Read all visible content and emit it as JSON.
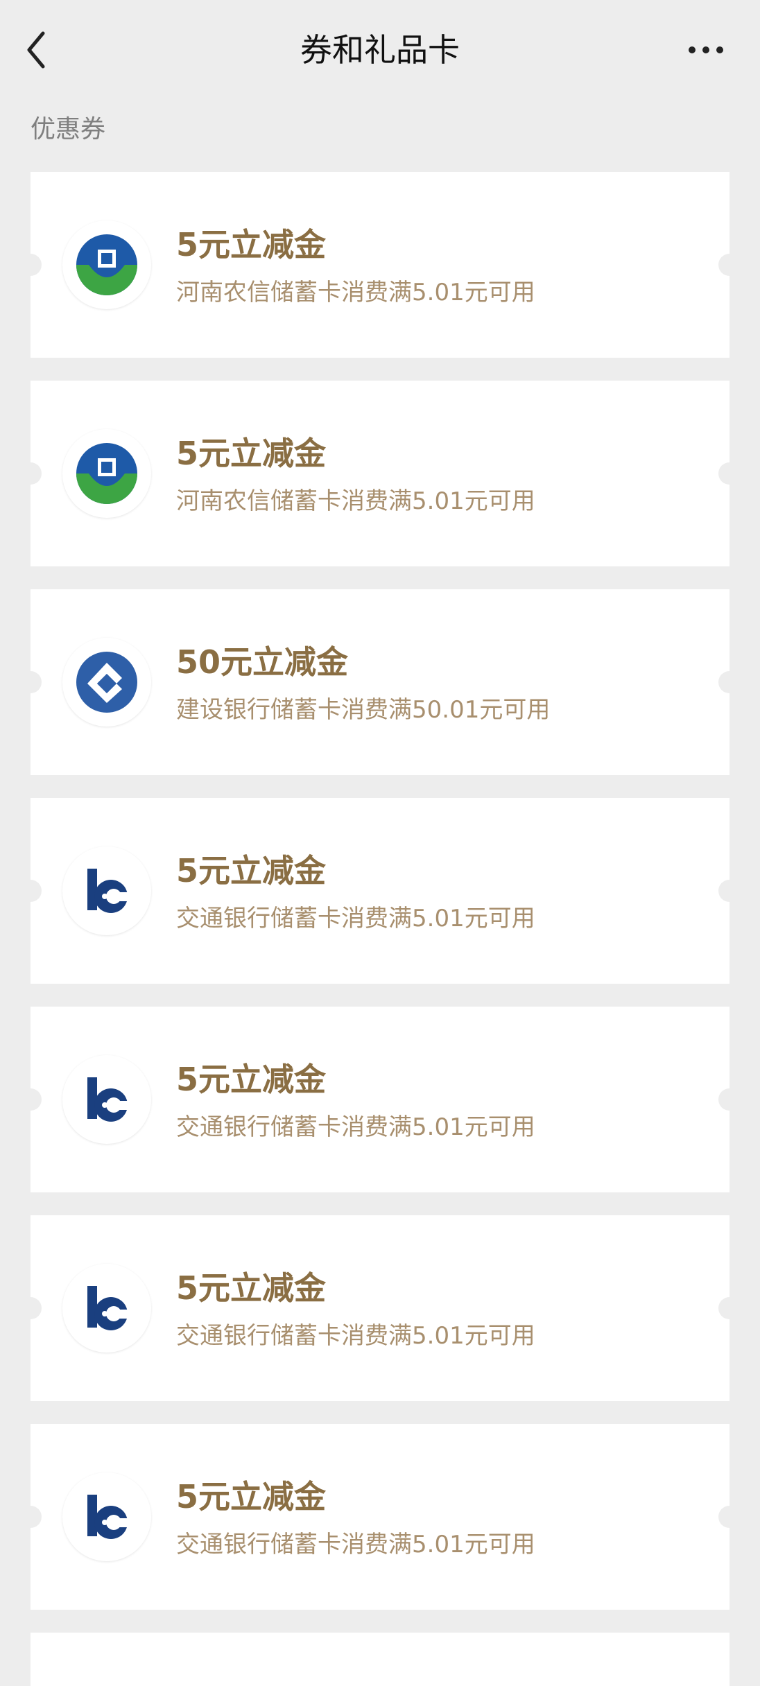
{
  "nav": {
    "title": "券和礼品卡",
    "back_icon": "chevron-left-icon",
    "more_icon": "more-horizontal-icon"
  },
  "section": {
    "label": "优惠券"
  },
  "colors": {
    "background": "#EDEDED",
    "card": "#FFFFFF",
    "coupon_title": "#8A6E43",
    "coupon_desc": "#A88F6E",
    "rural_credit_blue": "#1E5AA8",
    "rural_credit_green": "#3DA544",
    "ccb_blue": "#2E5FA8",
    "bocom_navy": "#1A3F7F"
  },
  "coupons": [
    {
      "bank": "rural-credit",
      "logo_icon": "henan-rural-credit-logo-icon",
      "title": "5元立减金",
      "desc": "河南农信储蓄卡消费满5.01元可用"
    },
    {
      "bank": "rural-credit",
      "logo_icon": "henan-rural-credit-logo-icon",
      "title": "5元立减金",
      "desc": "河南农信储蓄卡消费满5.01元可用"
    },
    {
      "bank": "ccb",
      "logo_icon": "ccb-logo-icon",
      "title": "50元立减金",
      "desc": "建设银行储蓄卡消费满50.01元可用"
    },
    {
      "bank": "bocom",
      "logo_icon": "bocom-logo-icon",
      "title": "5元立减金",
      "desc": "交通银行储蓄卡消费满5.01元可用"
    },
    {
      "bank": "bocom",
      "logo_icon": "bocom-logo-icon",
      "title": "5元立减金",
      "desc": "交通银行储蓄卡消费满5.01元可用"
    },
    {
      "bank": "bocom",
      "logo_icon": "bocom-logo-icon",
      "title": "5元立减金",
      "desc": "交通银行储蓄卡消费满5.01元可用"
    },
    {
      "bank": "bocom",
      "logo_icon": "bocom-logo-icon",
      "title": "5元立减金",
      "desc": "交通银行储蓄卡消费满5.01元可用"
    }
  ]
}
